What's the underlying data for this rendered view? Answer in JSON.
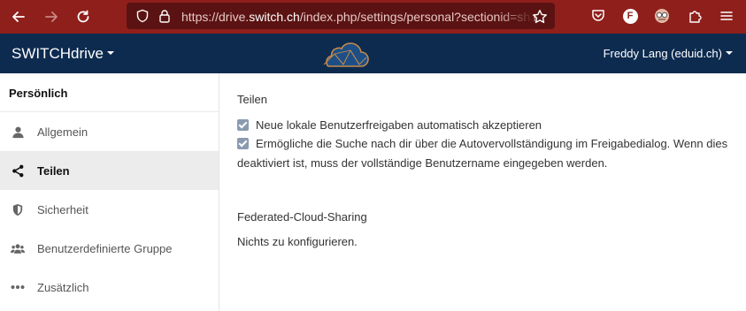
{
  "browser": {
    "url_prefix": "https://drive.",
    "url_host": "switch.ch",
    "url_rest": "/index.php/settings/personal?sectionid=sharing",
    "profile_letter": "F"
  },
  "header": {
    "brand": "SWITCHdrive",
    "user": "Freddy Lang (eduid.ch)"
  },
  "sidebar": {
    "title": "Persönlich",
    "items": [
      {
        "label": "Allgemein",
        "icon": "user-icon"
      },
      {
        "label": "Teilen",
        "icon": "share-icon",
        "active": true
      },
      {
        "label": "Sicherheit",
        "icon": "shield-icon"
      },
      {
        "label": "Benutzerdefinierte Gruppe",
        "icon": "users-icon"
      },
      {
        "label": "Zusätzlich",
        "icon": "more-icon"
      }
    ]
  },
  "main": {
    "sharing_title": "Teilen",
    "option1": "Neue lokale Benutzerfreigaben automatisch akzeptieren",
    "option2": "Ermögliche die Suche nach dir über die Autovervollständigung im Freigabedialog. Wenn dies deaktiviert ist, muss der vollständige Benutzername eingegeben werden.",
    "option1_checked": true,
    "option2_checked": true,
    "federated_title": "Federated-Cloud-Sharing",
    "federated_text": "Nichts zu konfigurieren."
  },
  "colors": {
    "browser_bar": "#8f1f1b",
    "header_bg": "#0d2b4f",
    "active_item_bg": "#ececec",
    "checkbox": "#8a9bb0"
  }
}
